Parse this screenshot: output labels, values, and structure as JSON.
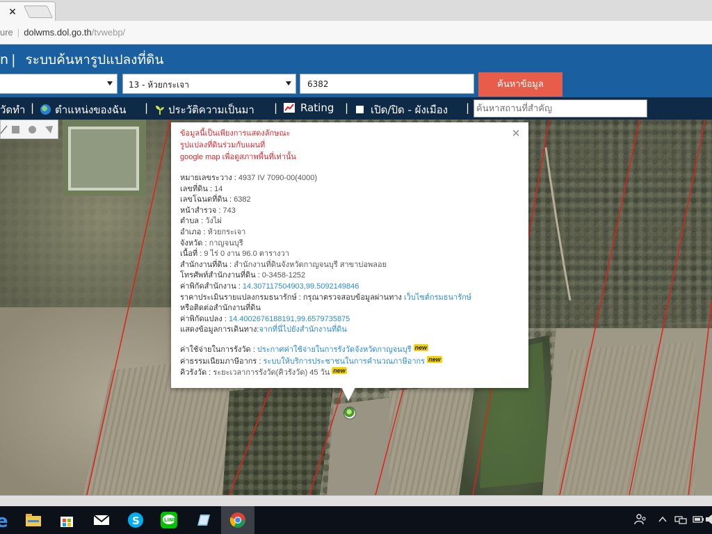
{
  "browser": {
    "tab_close": "×",
    "address_prefix": "ure",
    "address_host": "dolwms.dol.go.th",
    "address_path": "/tvwebp/"
  },
  "header": {
    "logo_fragment": "n",
    "title": "ระบบค้นหารูปแปลงที่ดิน"
  },
  "search": {
    "district_select": "13 - ห้วยกระเจา",
    "parcel_number": "6382",
    "search_button": "ค้นหาข้อมูล"
  },
  "toolbar": {
    "item_fragment": "วัดทำ",
    "my_location": "ตำแหน่งของฉัน",
    "history": "ประวัติความเป็นมา",
    "rating": "Rating",
    "toggle_plan": "เปิด/ปิด - ผังเมือง",
    "place_search_placeholder": "ค้นหาสถานที่สำคัญ"
  },
  "popup": {
    "close": "×",
    "disclaimer_1": "ข้อมูลนี้เป็นเพียงการแสดงลักษณะ",
    "disclaimer_2": "รูปแปลงที่ดินร่วมกับแผนที่",
    "disclaimer_3": "google map เพื่อดูสภาพพื้นที่เท่านั้น",
    "rows": [
      {
        "label": "หมายเลขระวาง : ",
        "value": "4937 IV 7090-00(4000)"
      },
      {
        "label": "เลขที่ดิน : ",
        "value": "14"
      },
      {
        "label": "เลขโฉนดที่ดิน : ",
        "value": "6382"
      },
      {
        "label": "หน้าสำรวจ : ",
        "value": "743"
      },
      {
        "label": "ตำบล : ",
        "value": "วังไผ่"
      },
      {
        "label": "อำเภอ : ",
        "value": "ห้วยกระเจา"
      },
      {
        "label": "จังหวัด : ",
        "value": "กาญจนบุรี"
      },
      {
        "label": "เนื้อที่ : ",
        "value": "9 ไร่ 0 งาน 96.0 ตารางวา"
      },
      {
        "label": "สำนักงานที่ดิน : ",
        "value": "สำนักงานที่ดินจังหวัดกาญจนบุรี สาขาบ่อพลอย"
      },
      {
        "label": "โทรศัพท์สำนักงานที่ดิน : ",
        "value": "0-3458-1252"
      }
    ],
    "office_coord_label": "ค่าพิกัดสำนักงาน : ",
    "office_coord_value": "14.307117504903,99.5092149846",
    "appraisal_label": "ราคาประเมินรายแปลงกรมธนารักษ์ : กรุณาตรวจสอบข้อมูลผ่านทาง ",
    "appraisal_link": "เว็บไซต์กรมธนารักษ์",
    "appraisal_line2": "หรือติดต่อสำนักงานที่ดิน",
    "parcel_coord_label": "ค่าพิกัดแปลง : ",
    "parcel_coord_value": "14.4002676188191,99.6579735875",
    "route_label": "แสดงข้อมูลการเดินทาง:",
    "route_link": "จากที่นี่ไปยังสำนักงานที่ดิน",
    "fee_label": "ค่าใช้จ่ายในการรังวัด : ",
    "fee_link": "ประกาศค่าใช้จ่ายในการรังวัดจังหวัดกาญจนบุรี",
    "tax_label": "ค่าธรรมเนียมภาษีอากร : ",
    "tax_link": "ระบบให้บริการประชาชนในการคำนวณภาษีอากร",
    "queue_label": "คิวรังวัด : ",
    "queue_value": "ระยะเวลาการรังวัด(คิวรังวัด) 45 วัน",
    "new_badge": "new"
  },
  "taskbar": {
    "apps": [
      "edge-icon",
      "file-explorer-icon",
      "store-icon",
      "mail-icon",
      "skype-icon",
      "line-icon",
      "app-icon",
      "chrome-icon"
    ]
  },
  "colors": {
    "header_blue": "#1a5fa0",
    "toolbar_navy": "#0e2a46",
    "search_button": "#e85c4a",
    "disclaimer_red": "#d9262b",
    "link_blue": "#2a8bd8",
    "parcel_line_red": "#e0201a"
  }
}
